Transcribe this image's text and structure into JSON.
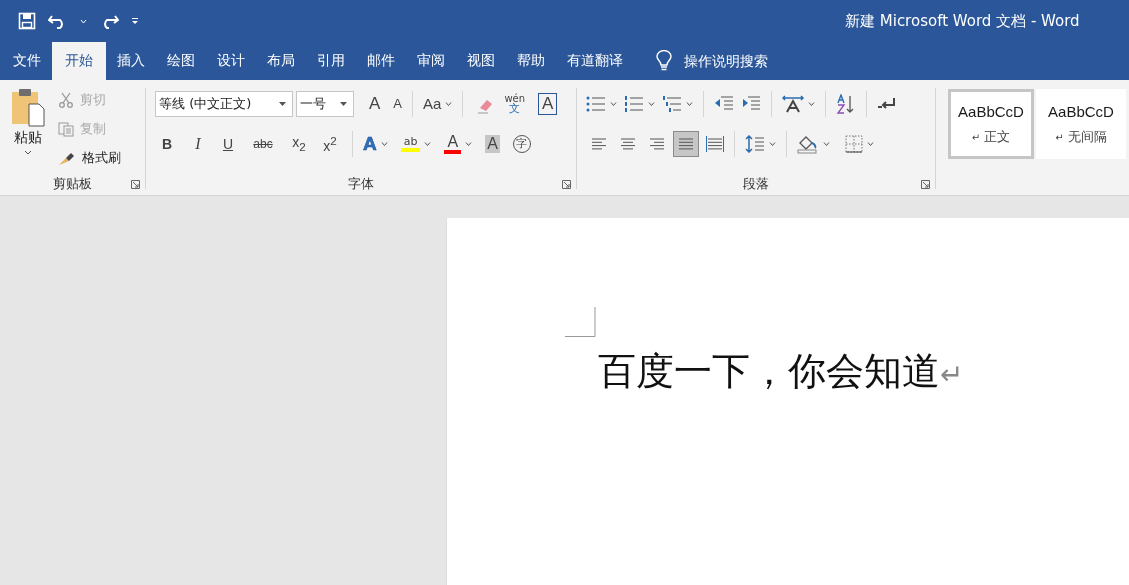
{
  "window": {
    "title": "新建 Microsoft Word 文档  -  Word"
  },
  "tabs": [
    {
      "label": "文件",
      "selected": false
    },
    {
      "label": "开始",
      "selected": true
    },
    {
      "label": "插入",
      "selected": false
    },
    {
      "label": "绘图",
      "selected": false
    },
    {
      "label": "设计",
      "selected": false
    },
    {
      "label": "布局",
      "selected": false
    },
    {
      "label": "引用",
      "selected": false
    },
    {
      "label": "邮件",
      "selected": false
    },
    {
      "label": "审阅",
      "selected": false
    },
    {
      "label": "视图",
      "selected": false
    },
    {
      "label": "帮助",
      "selected": false
    },
    {
      "label": "有道翻译",
      "selected": false
    }
  ],
  "search": {
    "placeholder": "操作说明搜索"
  },
  "clipboard": {
    "label": "剪贴板",
    "paste": "粘贴",
    "commands": [
      {
        "kind": "cut",
        "label": "剪切",
        "disabled": true
      },
      {
        "kind": "copy",
        "label": "复制",
        "disabled": true
      },
      {
        "kind": "painter",
        "label": "格式刷",
        "disabled": false
      }
    ]
  },
  "font": {
    "label": "字体",
    "font_name": "等线 (中文正文)",
    "font_size": "一号",
    "grow": "A",
    "shrink": "A",
    "change_case": "Aa",
    "phonetic_top": "wén",
    "phonetic_bottom": "文",
    "char_border": "A",
    "format_buttons": [
      {
        "kind": "bold",
        "glyph": "B"
      },
      {
        "kind": "italic",
        "glyph": "I"
      },
      {
        "kind": "underline",
        "glyph": "U"
      },
      {
        "kind": "strike",
        "glyph": "abc"
      },
      {
        "kind": "plain",
        "glyph": "x$_{2}$"
      },
      {
        "kind": "plain",
        "glyph": "x$^{2}$"
      }
    ],
    "text_effect": "A",
    "highlight": "ab",
    "font_color": "A",
    "shading": "A",
    "enclosed": "字"
  },
  "paragraph": {
    "label": "段落",
    "alignments": [
      {
        "kind": "left",
        "selected": false
      },
      {
        "kind": "center",
        "selected": false
      },
      {
        "kind": "right",
        "selected": false
      },
      {
        "kind": "justify",
        "selected": true
      },
      {
        "kind": "distributed",
        "selected": false
      }
    ]
  },
  "styles": [
    {
      "preview": "AaBbCcD",
      "mark": "↵",
      "name": "正文",
      "selected": true
    },
    {
      "preview": "AaBbCcD",
      "mark": "↵",
      "name": "无间隔",
      "selected": false
    }
  ],
  "document": {
    "text": "百度一下，你会知道",
    "para_mark": "↵"
  }
}
